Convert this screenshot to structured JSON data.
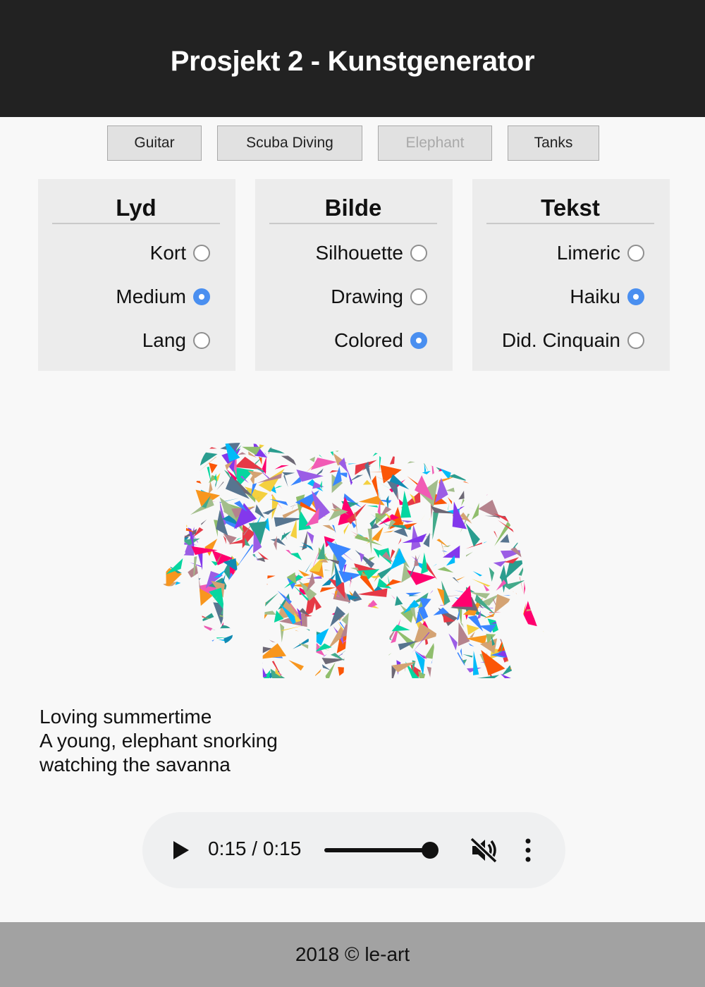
{
  "header": {
    "title": "Prosjekt 2 - Kunstgenerator"
  },
  "tabs": [
    {
      "label": "Guitar",
      "disabled": false
    },
    {
      "label": "Scuba Diving",
      "disabled": false
    },
    {
      "label": "Elephant",
      "disabled": true
    },
    {
      "label": "Tanks",
      "disabled": false
    }
  ],
  "panels": {
    "lyd": {
      "title": "Lyd",
      "options": [
        {
          "label": "Kort",
          "checked": false
        },
        {
          "label": "Medium",
          "checked": true
        },
        {
          "label": "Lang",
          "checked": false
        }
      ]
    },
    "bilde": {
      "title": "Bilde",
      "options": [
        {
          "label": "Silhouette",
          "checked": false
        },
        {
          "label": "Drawing",
          "checked": false
        },
        {
          "label": "Colored",
          "checked": true
        }
      ]
    },
    "tekst": {
      "title": "Tekst",
      "options": [
        {
          "label": "Limeric",
          "checked": false
        },
        {
          "label": "Haiku",
          "checked": true
        },
        {
          "label": "Did. Cinquain",
          "checked": false
        }
      ]
    }
  },
  "artwork": {
    "colors": [
      "#e63946",
      "#2a9d8f",
      "#f4d03f",
      "#3a86ff",
      "#8338ec",
      "#ff006e",
      "#fb5607",
      "#06d6a0",
      "#118ab2",
      "#a3be8c",
      "#d4a373",
      "#9b5de5",
      "#00bbf9",
      "#f15bb5",
      "#43aa8b",
      "#90be6d",
      "#577590",
      "#f8961e",
      "#b5838d",
      "#6d6875"
    ]
  },
  "poem": {
    "lines": [
      "Loving summertime",
      "A young, elephant snorking",
      "watching the savanna"
    ]
  },
  "audio": {
    "time": "0:15 / 0:15",
    "progress": 1.0,
    "muted": true,
    "play_icon": "play-icon",
    "mute_icon": "volume-muted-icon",
    "menu_icon": "more-vertical-icon"
  },
  "footer": {
    "text": "2018 © le-art"
  }
}
